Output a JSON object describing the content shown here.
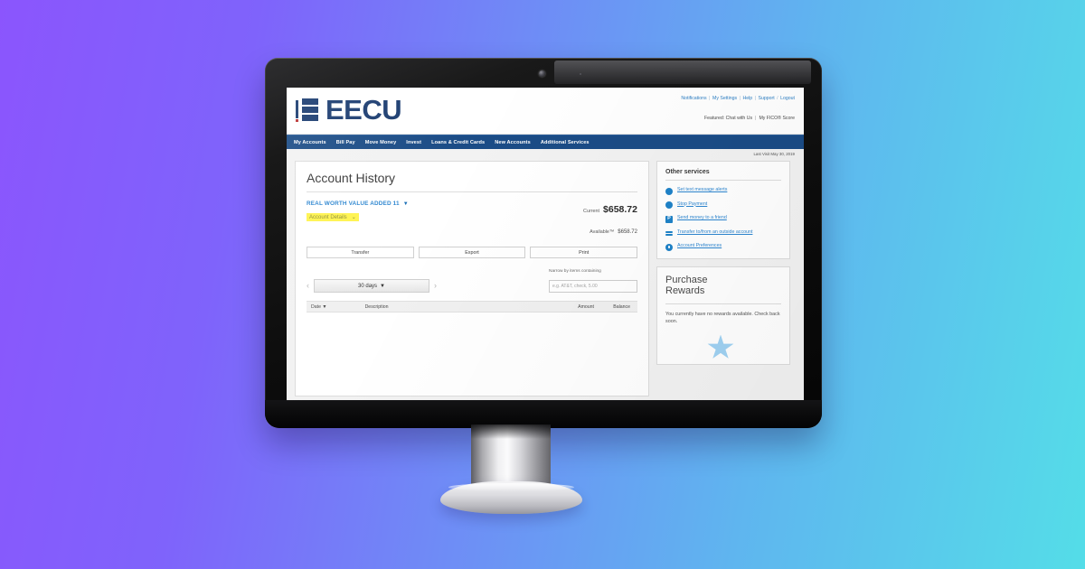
{
  "background": {
    "from": "#8b55fd",
    "to": "#54dde8"
  },
  "device": {
    "type": "desktop-monitor",
    "camera": "webcam-icon"
  },
  "site": {
    "brand": {
      "name": "EECU",
      "mark": "eecu-logo-icon",
      "color": "#1b3c70"
    },
    "utility_links": [
      "Notifications",
      "My Settings",
      "Help",
      "Support",
      "Logout"
    ],
    "featured_label": "Featured:",
    "featured_links": [
      "Chat with Us",
      "My FICO® Score"
    ],
    "nav": [
      "My Accounts",
      "Bill Pay",
      "Move Money",
      "Invest",
      "Loans & Credit Cards",
      "New Accounts",
      "Additional Services"
    ],
    "nav_bg": "#1b4c86",
    "last_visit": "Last Visit May 30, 2019"
  },
  "main": {
    "title": "Account History",
    "account_name": "REAL WORTH VALUE ADDED  11",
    "account_caret": "▼",
    "account_details_label": "Account Details",
    "account_details_chevron": "⌄",
    "account_details_highlight": "#fff44f",
    "balances": {
      "current_label": "Current",
      "current_value": "$658.72",
      "available_label": "Available™",
      "available_value": "$658.72"
    },
    "buttons": [
      "Transfer",
      "Export",
      "Print"
    ],
    "date_filter": {
      "prev_icon": "‹",
      "next_icon": "›",
      "selected": "30 days",
      "caret": "▼"
    },
    "search": {
      "label": "Narrow by items containing",
      "placeholder": "e.g. AT&T, check, 5.00",
      "value": ""
    },
    "table": {
      "columns": [
        "Date",
        "Description",
        "Amount",
        "Balance"
      ],
      "sort_caret": "▼",
      "rows": []
    }
  },
  "sidebar": {
    "services_title": "Other services",
    "services": [
      {
        "label": "Set text message alerts",
        "icon": "chat-bubble-icon"
      },
      {
        "label": "Stop Payment",
        "icon": "stop-hand-icon"
      },
      {
        "label": "Send money to a friend",
        "icon": "popmoney-p-icon"
      },
      {
        "label": "Transfer to/from an outside account",
        "icon": "transfer-arrows-icon"
      },
      {
        "label": "Account Preferences",
        "icon": "gear-icon"
      }
    ],
    "rewards": {
      "title_line1": "Purchase",
      "title_line2": "Rewards",
      "body": "You currently have no rewards available. Check back soon.",
      "graphic": "star-icon",
      "graphic_color": "#9fd2f3"
    }
  }
}
